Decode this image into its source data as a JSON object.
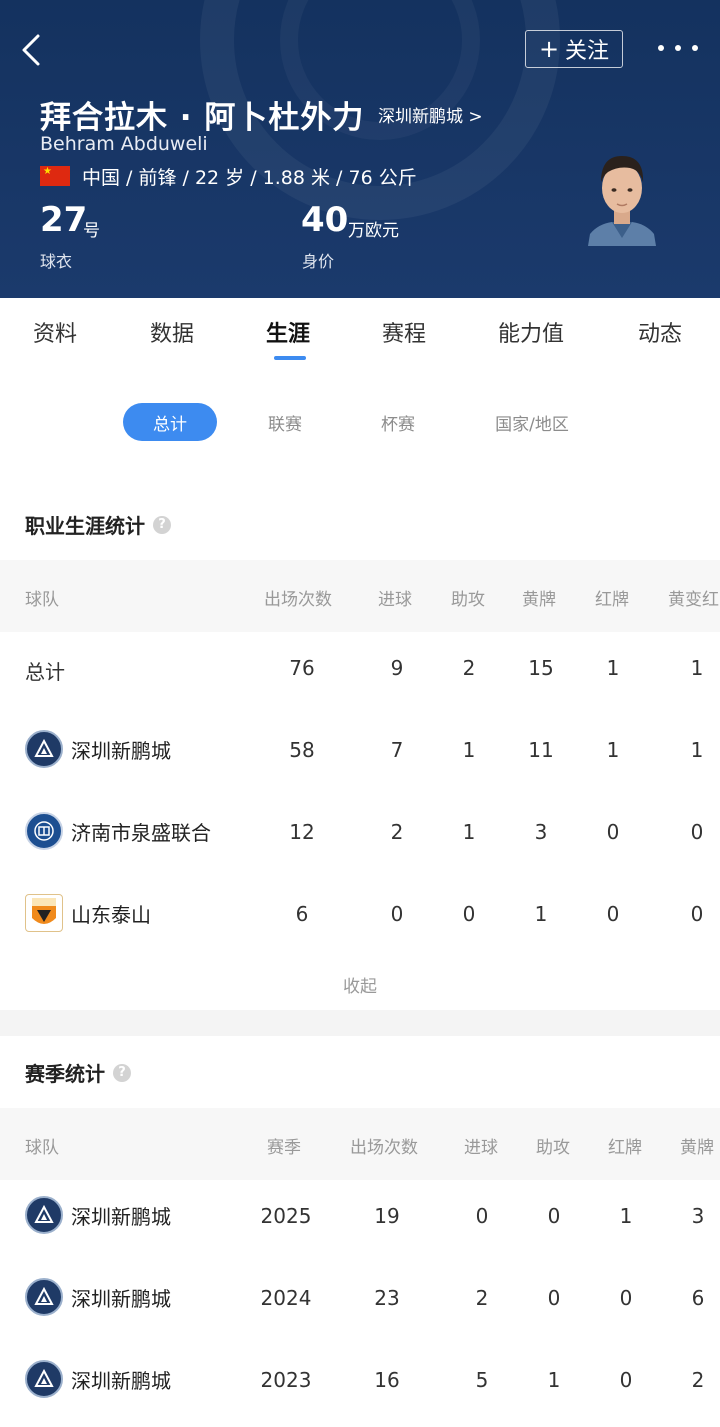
{
  "header": {
    "follow_label": "关注",
    "player_name": "拜合拉木 · 阿卜杜外力",
    "club_link": "深圳新鹏城 >",
    "name_en": "Behram Abduweli",
    "profile_line": "中国 / 前锋 / 22 岁 / 1.88 米 / 76 公斤",
    "shirt_number": "27",
    "shirt_unit": "号",
    "shirt_label": "球衣",
    "value_number": "40",
    "value_unit": "万欧元",
    "value_label": "身价"
  },
  "tabs": [
    "资料",
    "数据",
    "生涯",
    "赛程",
    "能力值",
    "动态"
  ],
  "active_tab": "生涯",
  "filters": [
    "总计",
    "联赛",
    "杯赛",
    "国家/地区"
  ],
  "career": {
    "title": "职业生涯统计",
    "columns": [
      "球队",
      "出场次数",
      "进球",
      "助攻",
      "黄牌",
      "红牌",
      "黄变红"
    ],
    "rows": [
      {
        "team": "总计",
        "apps": "76",
        "goals": "9",
        "assists": "2",
        "yellow": "15",
        "red": "1",
        "second_yellow": "1"
      },
      {
        "team": "深圳新鹏城",
        "apps": "58",
        "goals": "7",
        "assists": "1",
        "yellow": "11",
        "red": "1",
        "second_yellow": "1"
      },
      {
        "team": "济南市泉盛联合",
        "apps": "12",
        "goals": "2",
        "assists": "1",
        "yellow": "3",
        "red": "0",
        "second_yellow": "0"
      },
      {
        "team": "山东泰山",
        "apps": "6",
        "goals": "0",
        "assists": "0",
        "yellow": "1",
        "red": "0",
        "second_yellow": "0"
      }
    ],
    "collapse_label": "收起"
  },
  "season": {
    "title": "赛季统计",
    "columns": [
      "球队",
      "赛季",
      "出场次数",
      "进球",
      "助攻",
      "红牌",
      "黄牌"
    ],
    "rows": [
      {
        "team": "深圳新鹏城",
        "season": "2025",
        "apps": "19",
        "goals": "0",
        "assists": "0",
        "red": "1",
        "yellow": "3"
      },
      {
        "team": "深圳新鹏城",
        "season": "2024",
        "apps": "23",
        "goals": "2",
        "assists": "0",
        "red": "0",
        "yellow": "6"
      },
      {
        "team": "深圳新鹏城",
        "season": "2023",
        "apps": "16",
        "goals": "5",
        "assists": "1",
        "red": "0",
        "yellow": "2"
      }
    ]
  },
  "colors": {
    "header_bg": "#1b3a6c",
    "accent": "#3d8bf0"
  }
}
